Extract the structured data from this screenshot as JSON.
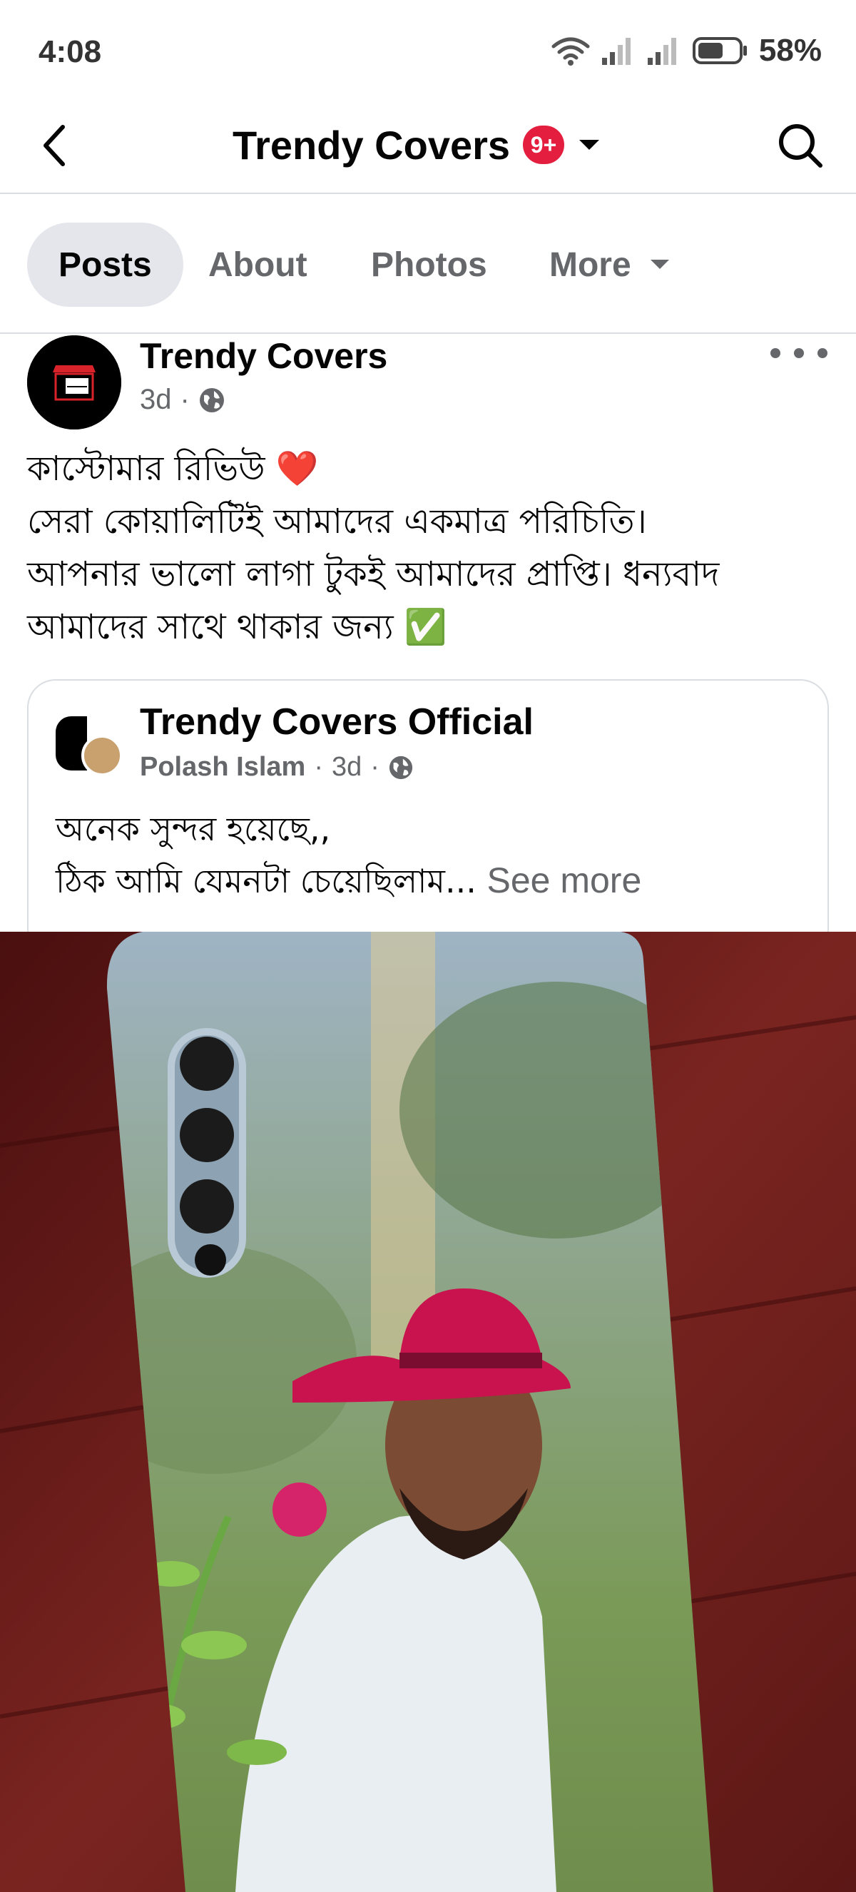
{
  "status_bar": {
    "time": "4:08",
    "battery": "58%",
    "icons": [
      "wifi-icon",
      "signal-icon",
      "signal-icon",
      "battery-icon"
    ]
  },
  "header": {
    "title": "Trendy Covers",
    "badge": "9+",
    "icons": [
      "back-arrow-icon",
      "chevron-down-icon",
      "search-icon"
    ]
  },
  "tabs": [
    {
      "label": "Posts",
      "active": true
    },
    {
      "label": "About",
      "active": false
    },
    {
      "label": "Photos",
      "active": false
    },
    {
      "label": "More",
      "active": false
    }
  ],
  "post": {
    "author": "Trendy Covers",
    "time": "3d",
    "lines": [
      "কাস্টোমার রিভিউ ❤️",
      "সেরা কোয়ালিটিই আমাদের একমাত্র পরিচিতি।",
      "আপনার ভালো লাগা টুকই আমাদের প্রাপ্তি। ধন্যবাদ",
      "আমাদের সাথে থাকার জন্য ✅"
    ]
  },
  "shared": {
    "name": "Trendy Covers Official",
    "poster": "Polash Islam",
    "time": "3d",
    "line1": "অনেক সুন্দর হয়েছে,,",
    "line2": "ঠিক আমি যেমনটা চেয়েছিলাম...",
    "see_more": "See more"
  },
  "colors": {
    "accent_red": "#e41e3f",
    "secondary_text": "#65676b",
    "tab_active_bg": "#e4e6eb"
  }
}
